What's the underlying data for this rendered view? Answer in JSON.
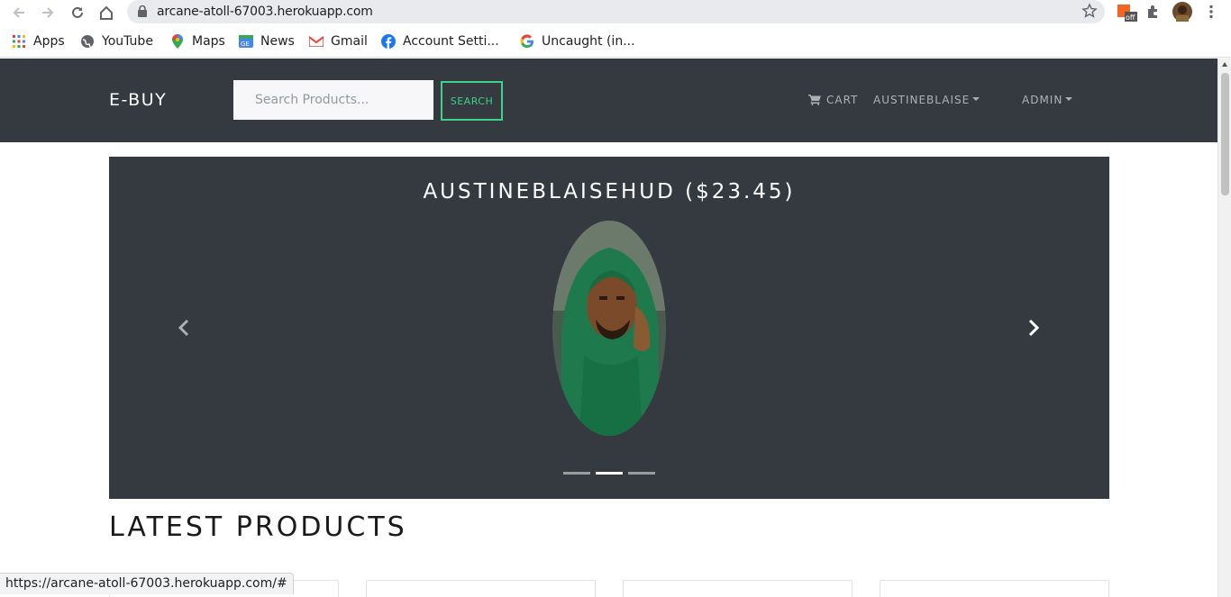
{
  "browser": {
    "url": "arcane-atoll-67003.herokuapp.com",
    "status_url": "https://arcane-atoll-67003.herokuapp.com/#",
    "bookmarks": [
      {
        "label": "Apps",
        "icon": "apps-grid-icon"
      },
      {
        "label": "YouTube",
        "icon": "youtube-globe-icon"
      },
      {
        "label": "Maps",
        "icon": "maps-pin-icon"
      },
      {
        "label": "News",
        "icon": "news-icon"
      },
      {
        "label": "Gmail",
        "icon": "gmail-icon"
      },
      {
        "label": "Account Setti...",
        "icon": "facebook-icon"
      },
      {
        "label": "Uncaught (in...",
        "icon": "google-icon"
      }
    ]
  },
  "navbar": {
    "brand": "E-BUY",
    "search_placeholder": "Search Products...",
    "search_label": "SEARCH",
    "cart_label": "CART",
    "user_label": "AUSTINEBLAISE",
    "admin_label": "ADMIN"
  },
  "carousel": {
    "title": "AUSTINEBLAISEHUD ($23.45)",
    "active_index": 1,
    "slide_count": 3
  },
  "main": {
    "section_title": "LATEST PRODUCTS"
  },
  "colors": {
    "navbar_bg": "#343a40",
    "accent": "#3fd08a"
  }
}
